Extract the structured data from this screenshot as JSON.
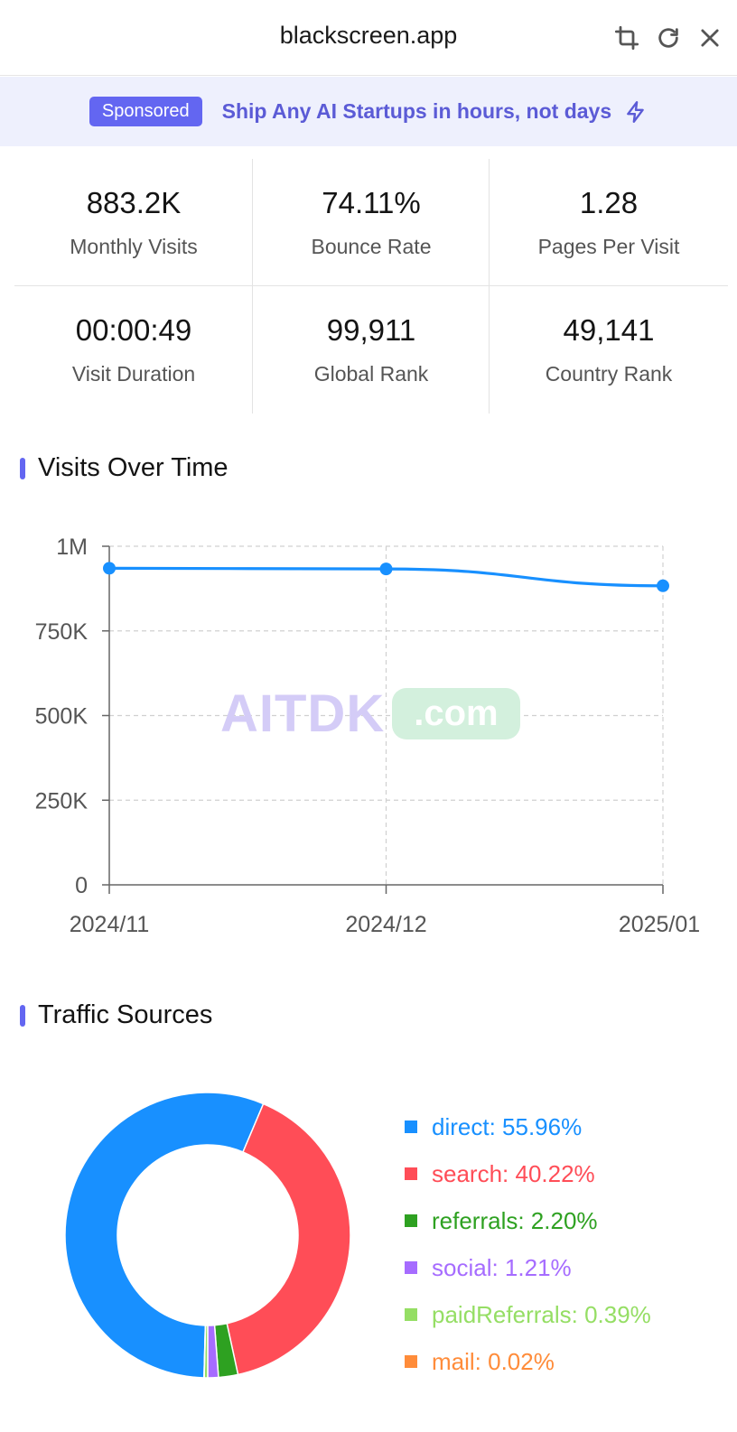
{
  "window": {
    "title": "blackscreen.app",
    "icons": [
      "crop-icon",
      "refresh-icon",
      "close-icon"
    ]
  },
  "banner": {
    "badge": "Sponsored",
    "text": "Ship Any AI Startups in hours, not days",
    "icon": "lightning-icon"
  },
  "stats": [
    {
      "value": "883.2K",
      "label": "Monthly Visits"
    },
    {
      "value": "74.11%",
      "label": "Bounce Rate"
    },
    {
      "value": "1.28",
      "label": "Pages Per Visit"
    },
    {
      "value": "00:00:49",
      "label": "Visit Duration"
    },
    {
      "value": "99,911",
      "label": "Global Rank"
    },
    {
      "value": "49,141",
      "label": "Country Rank"
    }
  ],
  "visits_section": {
    "title": "Visits Over Time"
  },
  "traffic_section": {
    "title": "Traffic Sources"
  },
  "watermark": {
    "main": "AITDK",
    "suffix": ".com"
  },
  "colors": {
    "accent": "#6366f1",
    "line": "#1890ff"
  },
  "chart_data": [
    {
      "type": "line",
      "categories": [
        "2024/11",
        "2024/12",
        "2025/01"
      ],
      "values": [
        935000,
        933000,
        883200
      ],
      "ylim": [
        0,
        1000000
      ],
      "yticks": [
        0,
        250000,
        500000,
        750000,
        1000000
      ],
      "ytick_labels": [
        "0",
        "250K",
        "500K",
        "750K",
        "1M"
      ],
      "grid": true,
      "color": "#1890ff"
    },
    {
      "type": "pie",
      "labels": [
        "direct",
        "search",
        "referrals",
        "social",
        "paidReferrals",
        "mail"
      ],
      "values": [
        55.96,
        40.22,
        2.2,
        1.21,
        0.39,
        0.02
      ],
      "legend_text": [
        "direct: 55.96%",
        "search: 40.22%",
        "referrals: 2.20%",
        "social: 1.21%",
        "paidReferrals: 0.39%",
        "mail: 0.02%"
      ],
      "colors": [
        "#1890ff",
        "#ff4d57",
        "#2ea121",
        "#a66cff",
        "#95de64",
        "#ff8c3a"
      ],
      "legend_position": "right"
    }
  ]
}
